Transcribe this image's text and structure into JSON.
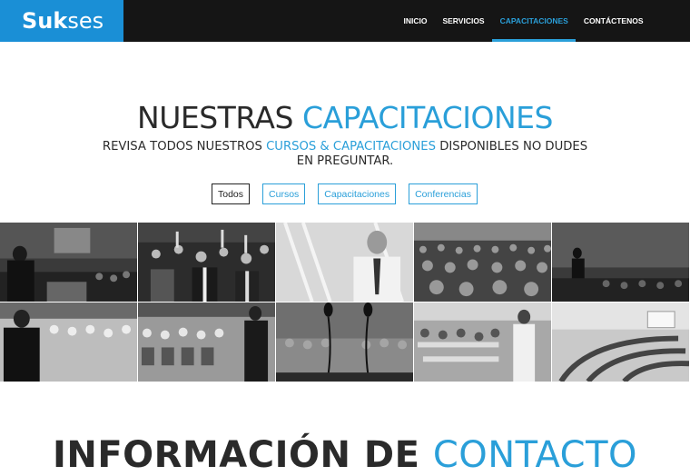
{
  "brand": {
    "logo_bold": "Suk",
    "logo_rest": "ses",
    "accent": "#2a9fd9",
    "logo_bg": "#1a8fd6"
  },
  "nav": {
    "items": [
      {
        "label": "INICIO"
      },
      {
        "label": "SERVICIOS"
      },
      {
        "label": "CAPACITACIONES",
        "active": true
      },
      {
        "label": "CONTÁCTENOS"
      }
    ]
  },
  "hero": {
    "title_dark": "NUESTRAS",
    "title_accent": "CAPACITACIONES",
    "sub_1": "REVISA TODOS NUESTROS",
    "sub_accent": "CURSOS & CAPACITACIONES",
    "sub_2": "DISPONIBLES NO DUDES EN PREGUNTAR."
  },
  "filters": [
    {
      "label": "Todos",
      "active": true
    },
    {
      "label": "Cursos"
    },
    {
      "label": "Capacitaciones"
    },
    {
      "label": "Conferencias"
    }
  ],
  "gallery": {
    "photos": [
      "speaker-at-podium",
      "audience-raising-hands",
      "presenter-portrait",
      "large-auditorium-audience",
      "speaker-silhouette-hall",
      "speaker-back-view",
      "seated-audience-speaker",
      "podium-microphones",
      "classroom-presenter",
      "empty-lecture-hall"
    ]
  },
  "contact": {
    "title_dark": "INFORMACIÓN DE",
    "title_accent": "CONTACTO"
  }
}
